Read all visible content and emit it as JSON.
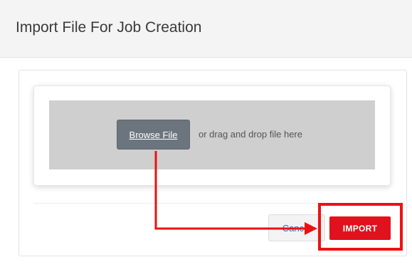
{
  "header": {
    "title": "Import File For Job Creation"
  },
  "upload": {
    "browse_label": "Browse File",
    "drop_hint": "or drag and drop file here"
  },
  "actions": {
    "cancel_label": "Cancel",
    "import_label": "IMPORT"
  },
  "colors": {
    "import_button": "#e0121d",
    "browse_button": "#6c757d",
    "dropzone": "#cfcfcf",
    "annotation": "#ee1111",
    "cancel_text": "#2f6fb5"
  }
}
